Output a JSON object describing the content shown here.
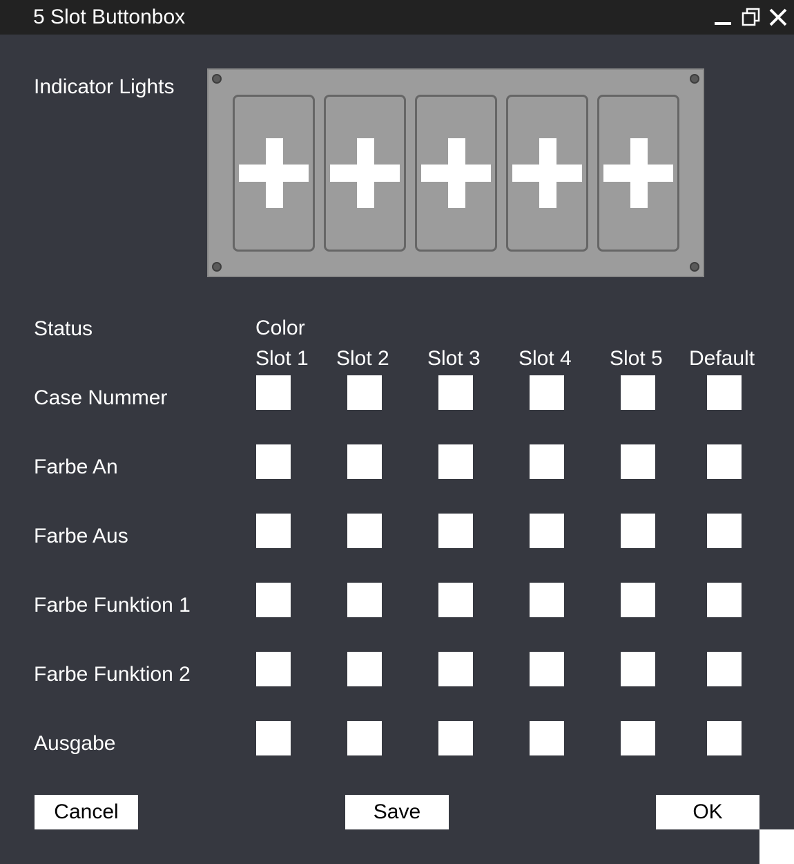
{
  "window": {
    "title": "5 Slot Buttonbox",
    "controls": {
      "minimize": "minimize-icon",
      "maximize": "restore-icon",
      "close": "close-icon"
    }
  },
  "indicator": {
    "label": "Indicator Lights",
    "slot_icon": "plus-icon",
    "slot_count": 5
  },
  "grid": {
    "status_header": "Status",
    "color_header": "Color",
    "columns": [
      "Slot 1",
      "Slot 2",
      "Slot 3",
      "Slot 4",
      "Slot 5",
      "Default"
    ],
    "rows": [
      "Case Nummer",
      "Farbe An",
      "Farbe Aus",
      "Farbe Funktion 1",
      "Farbe Funktion 2",
      "Ausgabe"
    ],
    "swatch_color": "#ffffff"
  },
  "buttons": {
    "cancel": "Cancel",
    "save": "Save",
    "ok": "OK"
  },
  "colors": {
    "background": "#363840",
    "titlebar": "#222222",
    "panel": "#9c9c9c",
    "slot_border": "#666666"
  }
}
